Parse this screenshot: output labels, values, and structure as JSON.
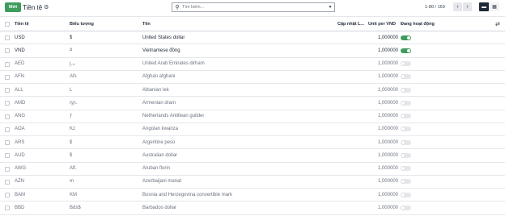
{
  "toolbar": {
    "new_label": "Mới",
    "title": "Tiền tệ",
    "search_placeholder": "Tìm kiếm...",
    "pager": "1-80 / 169"
  },
  "icons": {
    "gear": "gear-icon",
    "search": "search-icon",
    "dropdown": "caret-down-icon",
    "prev": "chevron-left-icon",
    "next": "chevron-right-icon",
    "list_view": "list-view-icon",
    "kanban_view": "kanban-view-icon",
    "optional_columns": "sliders-icon"
  },
  "colors": {
    "primary": "#3f9b5e",
    "toggle_off": "#e5e7eb",
    "active_view": "#1f2937"
  },
  "columns": {
    "currency": "Tiền tệ",
    "symbol": "Biểu tượng",
    "name": "Tên",
    "last_update": "Cập nhật L...",
    "rate": "Unit per VND",
    "active": "Đang hoạt động"
  },
  "rows": [
    {
      "code": "USD",
      "symbol": "$",
      "name": "United States dollar",
      "rate": "1,000000",
      "active": true
    },
    {
      "code": "VND",
      "symbol": "₫",
      "name": "Vietnamese đồng",
      "rate": "1,000000",
      "active": true
    },
    {
      "code": "AED",
      "symbol": "د.إ",
      "name": "United Arab Emirates dirham",
      "rate": "1,000000",
      "active": false
    },
    {
      "code": "AFN",
      "symbol": "Afs",
      "name": "Afghan afghani",
      "rate": "1,000000",
      "active": false
    },
    {
      "code": "ALL",
      "symbol": "L",
      "name": "Albanian lek",
      "rate": "1,000000",
      "active": false
    },
    {
      "code": "AMD",
      "symbol": "դր.",
      "name": "Armenian dram",
      "rate": "1,000000",
      "active": false
    },
    {
      "code": "ANG",
      "symbol": "ƒ",
      "name": "Netherlands Antillean guilder",
      "rate": "1,000000",
      "active": false
    },
    {
      "code": "AOA",
      "symbol": "Kz",
      "name": "Angolan kwanza",
      "rate": "1,000000",
      "active": false
    },
    {
      "code": "ARS",
      "symbol": "$",
      "name": "Argentine peso",
      "rate": "1,000000",
      "active": false
    },
    {
      "code": "AUD",
      "symbol": "$",
      "name": "Australian dollar",
      "rate": "1,000000",
      "active": false
    },
    {
      "code": "AWG",
      "symbol": "Afl.",
      "name": "Aruban florin",
      "rate": "1,000000",
      "active": false
    },
    {
      "code": "AZN",
      "symbol": "m",
      "name": "Azerbaijani manat",
      "rate": "1,000000",
      "active": false
    },
    {
      "code": "BAM",
      "symbol": "KM",
      "name": "Bosnia and Herzegovina convertible mark",
      "rate": "1,000000",
      "active": false
    },
    {
      "code": "BBD",
      "symbol": "Bds$",
      "name": "Barbados dollar",
      "rate": "1,000000",
      "active": false
    }
  ]
}
